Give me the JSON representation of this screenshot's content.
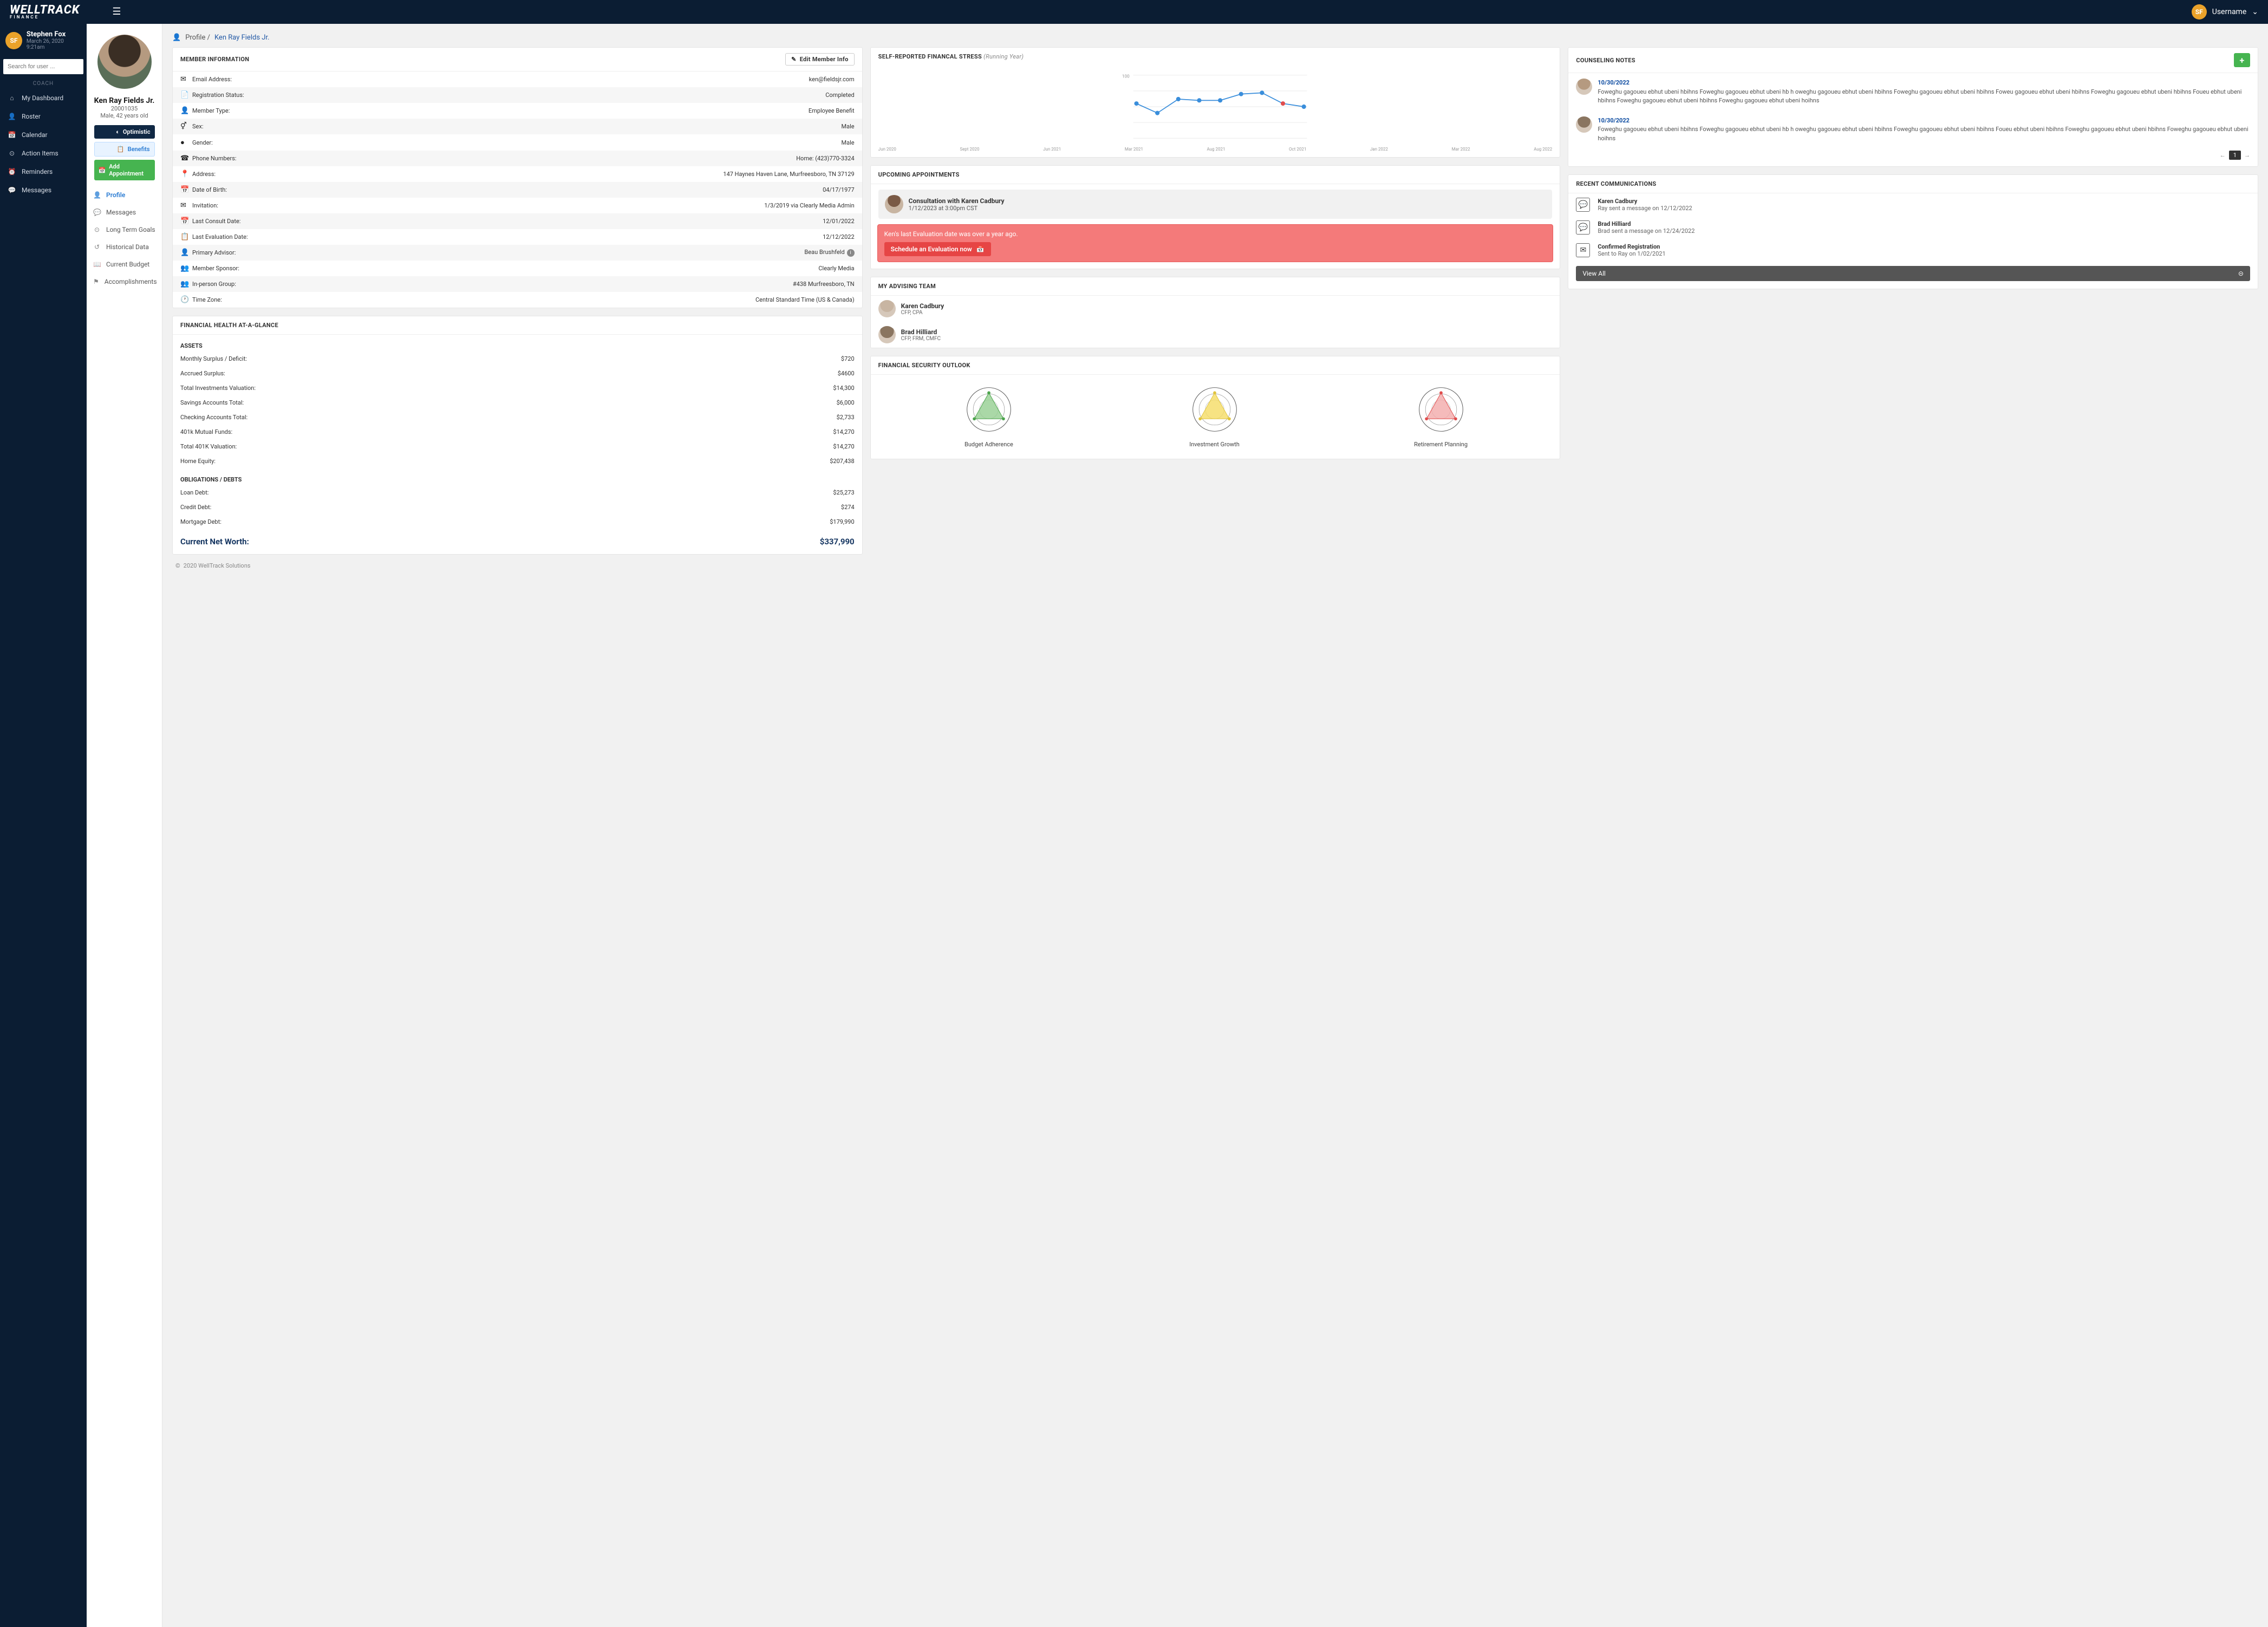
{
  "brand": {
    "name": "WELLTRACK",
    "sub": "FINANCE"
  },
  "topbar": {
    "username": "Username",
    "avatar_initials": "SF",
    "avatar_bg": "#eaa22a"
  },
  "sidebar": {
    "user": {
      "initials": "SF",
      "name": "Stephen Fox",
      "datetime": "March 26, 2020 9:21am",
      "avatar_bg": "#eaa22a"
    },
    "search_placeholder": "Search for user ...",
    "section_label": "COACH",
    "items": [
      {
        "icon": "⌂",
        "label": "My Dashboard"
      },
      {
        "icon": "👤",
        "label": "Roster"
      },
      {
        "icon": "📅",
        "label": "Calendar"
      },
      {
        "icon": "⊙",
        "label": "Action Items"
      },
      {
        "icon": "⏰",
        "label": "Reminders"
      },
      {
        "icon": "💬",
        "label": "Messages"
      }
    ]
  },
  "profile_col": {
    "name": "Ken Ray Fields Jr.",
    "id": "20001035",
    "demo": "Male, 42 years old",
    "pills": {
      "optimistic": "Optimistic",
      "benefits": "Benefits",
      "add_appt": "Add Appointment"
    },
    "tabs": [
      {
        "icon": "👤",
        "label": "Profile",
        "active": true
      },
      {
        "icon": "💬",
        "label": "Messages"
      },
      {
        "icon": "⊙",
        "label": "Long Term Goals"
      },
      {
        "icon": "↺",
        "label": "Historical Data"
      },
      {
        "icon": "📖",
        "label": "Current Budget"
      },
      {
        "icon": "⚑",
        "label": "Accomplishments"
      }
    ]
  },
  "breadcrumb": {
    "prefix": "Profile /",
    "current": "Ken Ray Fields Jr."
  },
  "member_info": {
    "title": "MEMBER INFORMATION",
    "edit_label": "Edit Member Info",
    "rows": [
      {
        "icon": "✉",
        "label": "Email Address:",
        "value": "ken@fieldsjr.com"
      },
      {
        "icon": "📄",
        "label": "Registration Status:",
        "value": "Completed"
      },
      {
        "icon": "👤",
        "label": "Member Type:",
        "value": "Employee Benefit"
      },
      {
        "icon": "⚥",
        "label": "Sex:",
        "value": "Male"
      },
      {
        "icon": "●",
        "label": "Gender:",
        "value": "Male"
      },
      {
        "icon": "☎",
        "label": "Phone Numbers:",
        "value": "Home: (423)770-3324"
      },
      {
        "icon": "📍",
        "label": "Address:",
        "value": "147 Haynes Haven Lane, Murfreesboro, TN 37129"
      },
      {
        "icon": "📅",
        "label": "Date of Birth:",
        "value": "04/17/1977"
      },
      {
        "icon": "✉",
        "label": "Invitation:",
        "value": "1/3/2019 via Clearly Media Admin"
      },
      {
        "icon": "📅",
        "label": "Last Consult Date:",
        "value": "12/01/2022"
      },
      {
        "icon": "📋",
        "label": "Last Evaluation Date:",
        "value": "12/12/2022"
      },
      {
        "icon": "👤",
        "label": "Primary Advisor:",
        "value": "Beau Brushfeld",
        "info": true
      },
      {
        "icon": "👥",
        "label": "Member Sponsor:",
        "value": "Clearly Media"
      },
      {
        "icon": "👥",
        "label": "In-person Group:",
        "value": "#438 Murfreesboro, TN"
      },
      {
        "icon": "🕐",
        "label": "Time Zone:",
        "value": "Central Standard Time (US & Canada)"
      }
    ]
  },
  "fin_health": {
    "title": "FINANCIAL HEALTH AT-A-GLANCE",
    "assets_label": "ASSETS",
    "assets": [
      {
        "label": "Monthly Surplus / Deficit:",
        "value": "$720"
      },
      {
        "label": "Accrued Surplus:",
        "value": "$4600"
      },
      {
        "label": "Total Investments Valuation:",
        "value": "$14,300"
      },
      {
        "label": "Savings Accounts Total:",
        "value": "$6,000"
      },
      {
        "label": "Checking Accounts Total:",
        "value": "$2,733"
      },
      {
        "label": "401k Mutual Funds:",
        "value": "$14,270"
      },
      {
        "label": "Total 401K Valuation:",
        "value": "$14,270"
      },
      {
        "label": "Home Equity:",
        "value": "$207,438"
      }
    ],
    "debts_label": "OBLIGATIONS / DEBTS",
    "debts": [
      {
        "label": "Loan Debt:",
        "value": "$25,273"
      },
      {
        "label": "Credit Debt:",
        "value": "$274"
      },
      {
        "label": "Mortgage Debt:",
        "value": "$179,990"
      }
    ],
    "net_label": "Current Net Worth:",
    "net_value": "$337,990"
  },
  "stress": {
    "title": "SELF-REPORTED FINANCAL STRESS",
    "subtitle": "(Running Year)",
    "ymax": 100,
    "months": [
      "Jun 2020",
      "Sept 2020",
      "Jun 2021",
      "Mar 2021",
      "Aug 2021",
      "Oct 2021",
      "Jan 2022",
      "Mar 2022",
      "Aug 2022"
    ]
  },
  "chart_data": {
    "type": "line",
    "title": "Self-reported financial stress (running year)",
    "x": [
      "Jun 2020",
      "Sept 2020",
      "Jun 2021",
      "Mar 2021",
      "Aug 2021",
      "Oct 2021",
      "Jan 2022",
      "Mar 2022",
      "Aug 2022"
    ],
    "values": [
      55,
      40,
      62,
      60,
      60,
      70,
      72,
      55,
      50
    ],
    "highlight_index": 7,
    "ylim": [
      0,
      100
    ],
    "ylabel": "",
    "xlabel": ""
  },
  "appts": {
    "title": "UPCOMING APPOINTMENTS",
    "item": {
      "title": "Consultation with Karen Cadbury",
      "when": "1/12/2023 at 3:00pm CST"
    },
    "alert_text": "Ken's last Evaluation date was over a year ago.",
    "alert_btn": "Schedule an Evaluation now"
  },
  "team": {
    "title": "MY ADVISING TEAM",
    "members": [
      {
        "name": "Karen Cadbury",
        "creds": "CFP, CPA",
        "bg": "#c8b5a2"
      },
      {
        "name": "Brad Hilliard",
        "creds": "CFP, FRM, CMFC",
        "bg": "#8a7560"
      }
    ]
  },
  "outlook": {
    "title": "FINANCIAL SECURITY OUTLOOK",
    "charts": [
      {
        "label": "Budget Adherence",
        "fill": "#8ecb8a",
        "dot": "#4da44d"
      },
      {
        "label": "Investment Growth",
        "fill": "#f4d95a",
        "dot": "#e0c43e"
      },
      {
        "label": "Retirement Planning",
        "fill": "#f2a4a4",
        "dot": "#e04d4d"
      }
    ]
  },
  "notes": {
    "title": "COUNSELING NOTES",
    "add": "+",
    "items": [
      {
        "date": "10/30/2022",
        "text": "Foweghu gagoueu ebhut ubeni hbihns Foweghu gagoueu ebhut ubeni hb h oweghu gagoueu ebhut ubeni hbihns Foweghu gagoueu ebhut ubeni hbihns Foweu gagoueu ebhut ubeni hbihns Foweghu gagoueu ebhut ubeni hbihns Foueu ebhut ubeni hbihns Foweghu gagoueu ebhut ubeni hbihns Foweghu gagoueu ebhut ubeni hoihns",
        "bg": "#b59a80"
      },
      {
        "date": "10/30/2022",
        "text": "Foweghu gagoueu ebhut ubeni hbihns Foweghu gagoueu ebhut ubeni hb h oweghu gagoueu ebhut ubeni hbihns Foweghu gagoueu ebhut ubeni hbihns Foueu ebhut ubeni hbihns Foweghu gagoueu ebhut ubeni hbihns Foweghu gagoueu ebhut ubeni hoihns",
        "bg": "#8a7560"
      }
    ],
    "page": "1"
  },
  "comms": {
    "title": "RECENT COMMUNICATIONS",
    "items": [
      {
        "icon": "💬",
        "title": "Karen Cadbury",
        "sub": "Ray sent a message on 12/12/2022"
      },
      {
        "icon": "💬",
        "title": "Brad Hilliard",
        "sub": "Brad sent a message on 12/24/2022"
      },
      {
        "icon": "✉",
        "title": "Confirmed Registration",
        "sub": "Sent to Ray on 1/02/2021"
      }
    ],
    "viewall": "View All"
  },
  "footer": "2020 WellTrack Solutions"
}
